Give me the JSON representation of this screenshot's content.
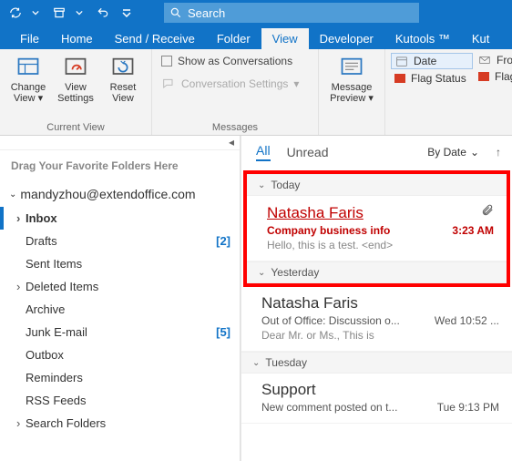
{
  "search": {
    "placeholder": "Search"
  },
  "tabs": [
    "File",
    "Home",
    "Send / Receive",
    "Folder",
    "View",
    "Developer",
    "Kutools ™",
    "Kut"
  ],
  "active_tab": "View",
  "ribbon": {
    "change_view": "Change View",
    "view_settings": "View Settings",
    "reset_view": "Reset View",
    "current_view_label": "Current View",
    "show_conversations": "Show as Conversations",
    "conversation_settings": "Conversation Settings",
    "messages_label": "Messages",
    "message_preview": "Message Preview",
    "date": "Date",
    "from": "From",
    "flag_status": "Flag Status",
    "flag_start": "Flag: Sta"
  },
  "sidebar": {
    "fav_text": "Drag Your Favorite Folders Here",
    "account": "mandyzhou@extendoffice.com",
    "folders": [
      {
        "name": "Inbox",
        "expandable": true,
        "selected": true,
        "count": ""
      },
      {
        "name": "Drafts",
        "count": "[2]"
      },
      {
        "name": "Sent Items",
        "count": ""
      },
      {
        "name": "Deleted Items",
        "expandable": true,
        "count": ""
      },
      {
        "name": "Archive",
        "count": ""
      },
      {
        "name": "Junk E-mail",
        "count": "[5]"
      },
      {
        "name": "Outbox",
        "count": ""
      },
      {
        "name": "Reminders",
        "count": ""
      },
      {
        "name": "RSS Feeds",
        "count": ""
      },
      {
        "name": "Search Folders",
        "expandable": true,
        "count": ""
      }
    ]
  },
  "msglist": {
    "filter_all": "All",
    "filter_unread": "Unread",
    "sort_label": "By Date",
    "groups": {
      "today": "Today",
      "yesterday": "Yesterday",
      "tuesday": "Tuesday"
    },
    "items": [
      {
        "sender": "Natasha Faris",
        "subject": "Company business info",
        "time": "3:23 AM",
        "preview": "Hello, this is a test. <end>",
        "attach": true,
        "hl": true
      },
      {
        "sender": "Natasha Faris",
        "subject": "Out of Office: Discussion o...",
        "time": "Wed 10:52 ...",
        "preview": "Dear Mr. or Ms.,   This is"
      },
      {
        "sender": "Support",
        "subject": "New comment posted on t...",
        "time": "Tue 9:13 PM",
        "preview": ""
      }
    ]
  }
}
